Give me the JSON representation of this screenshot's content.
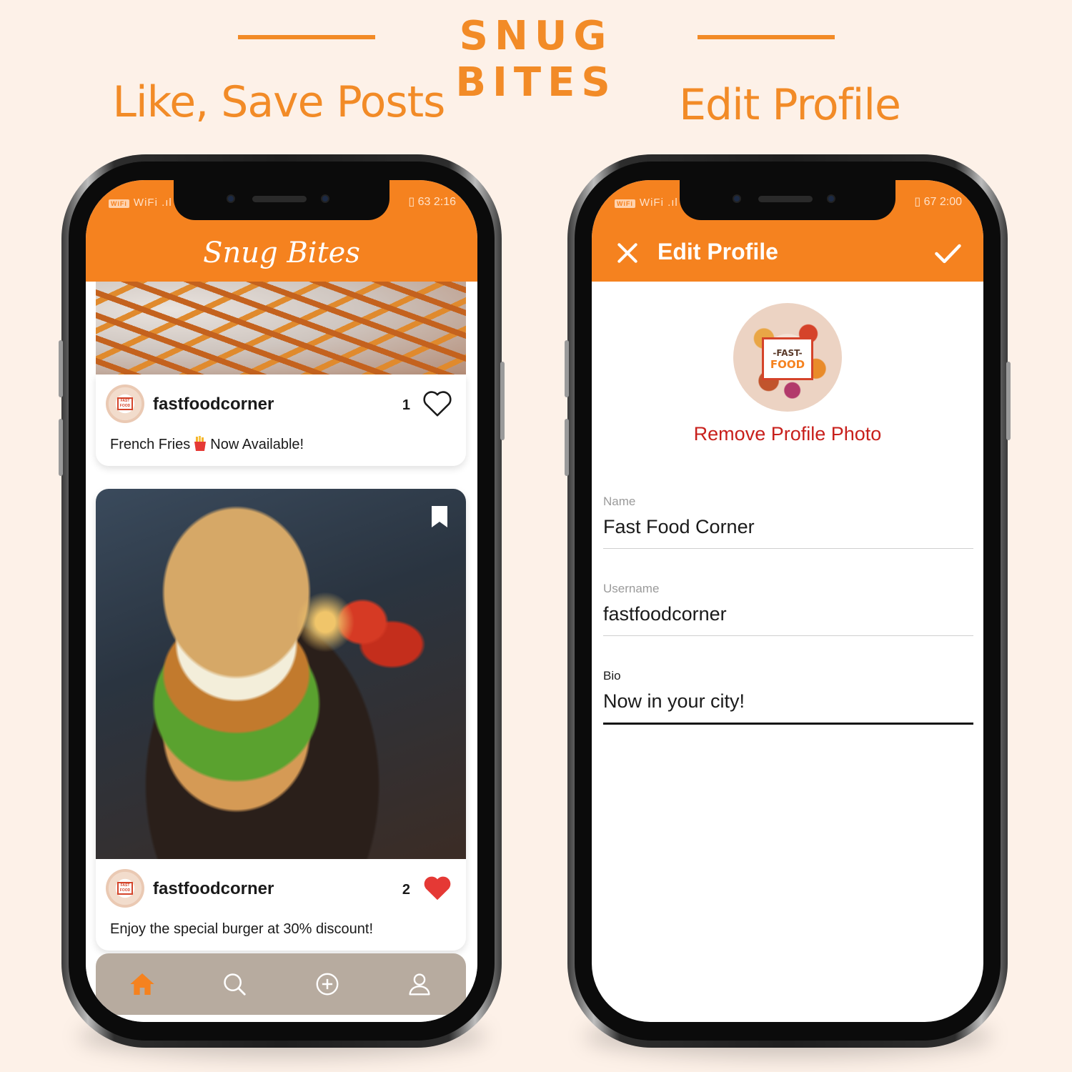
{
  "banner": {
    "title": "SNUG BITES",
    "left_caption": "Like, Save Posts",
    "right_caption": "Edit Profile"
  },
  "colors": {
    "accent": "#f5821f",
    "background": "#fdf1e8",
    "danger": "#c8201c",
    "heart": "#e53935",
    "nav_bg": "#b7ab9f"
  },
  "left_phone": {
    "status": {
      "left": "WiFi .ıl ≋",
      "right": "▯ 63 2:16"
    },
    "app_title": "Snug Bites",
    "posts": [
      {
        "image": "french-fries-photo",
        "username": "fastfoodcorner",
        "likes": "1",
        "liked": false,
        "caption_before": "French Fries",
        "caption_after": "Now Available!",
        "caption_emoji": "fries-emoji"
      },
      {
        "image": "burger-photo",
        "username": "fastfoodcorner",
        "likes": "2",
        "liked": true,
        "saved": true,
        "caption": "Enjoy the special burger at 30% discount!"
      }
    ],
    "bottom_nav": [
      {
        "icon": "home-icon",
        "active": true
      },
      {
        "icon": "search-icon",
        "active": false
      },
      {
        "icon": "add-post-icon",
        "active": false
      },
      {
        "icon": "profile-icon",
        "active": false
      }
    ]
  },
  "right_phone": {
    "status": {
      "left": "WiFi .ıl ≋",
      "right": "▯ 67 2:00"
    },
    "title": "Edit Profile",
    "profile_photo_text": {
      "line1": "-FAST-",
      "line2": "FOOD"
    },
    "remove_photo_label": "Remove Profile Photo",
    "fields": {
      "name": {
        "label": "Name",
        "value": "Fast Food Corner"
      },
      "username": {
        "label": "Username",
        "value": "fastfoodcorner"
      },
      "bio": {
        "label": "Bio",
        "value": "Now in your city!"
      }
    }
  }
}
